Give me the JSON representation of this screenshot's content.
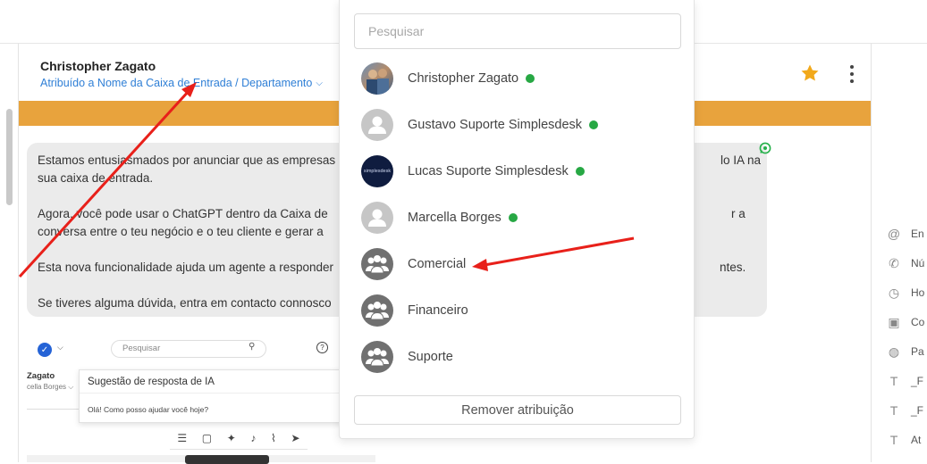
{
  "conversation": {
    "contact_name": "Christopher Zagato",
    "assignment_label": "Atribuído a Nome da Caixa de Entrada / Departamento",
    "message": {
      "para1_left": "Estamos entusiasmados por anunciar que as empresas",
      "para1_left2": "sua caixa de entrada.",
      "para1_right": "lo IA na",
      "para2_left": "Agora, você pode usar o ChatGPT dentro da Caixa de",
      "para2_left2": "conversa entre o teu negócio e o teu cliente e gerar a",
      "para2_right": "r a",
      "para3_left": "Esta nova funcionalidade ajuda um agente a responder",
      "para3_right": "ntes.",
      "para4_left": "Se tiveres alguma dúvida, entra em contacto connosco"
    }
  },
  "embedded_screenshot": {
    "search_placeholder": "Pesquisar",
    "contact_name": "Zagato",
    "contact_sub": "cella Borges",
    "ai_title": "Sugestão de resposta de IA",
    "ai_text": "Olá! Como posso ajudar você hoje?"
  },
  "right_panel": {
    "rows": [
      {
        "icon": "at-icon",
        "label": "En"
      },
      {
        "icon": "phone-icon",
        "label": "Nú"
      },
      {
        "icon": "clock-icon",
        "label": "Ho"
      },
      {
        "icon": "contact-card-icon",
        "label": "Co"
      },
      {
        "icon": "globe-icon",
        "label": "Pa"
      },
      {
        "icon": "text-field-icon",
        "label": "_F"
      },
      {
        "icon": "text-field-icon",
        "label": "_F"
      },
      {
        "icon": "text-field-icon",
        "label": "At"
      }
    ]
  },
  "assign_dropdown": {
    "search_placeholder": "Pesquisar",
    "items": [
      {
        "label": "Christopher Zagato",
        "online": true,
        "avatar": "photo"
      },
      {
        "label": "Gustavo Suporte Simplesdesk",
        "online": true,
        "avatar": "default-user"
      },
      {
        "label": "Lucas Suporte Simplesdesk",
        "online": true,
        "avatar": "simplesdesk-logo",
        "avatar_text": "simplesdesk"
      },
      {
        "label": "Marcella Borges",
        "online": true,
        "avatar": "default-user"
      },
      {
        "label": "Comercial",
        "online": false,
        "avatar": "team"
      },
      {
        "label": "Financeiro",
        "online": false,
        "avatar": "team"
      },
      {
        "label": "Suporte",
        "online": false,
        "avatar": "team"
      }
    ],
    "remove_label": "Remover atribuição"
  },
  "colors": {
    "accent_orange": "#e8a33d",
    "link_blue": "#2f7fd6",
    "online_green": "#27a844",
    "annotation_red": "#e8201a",
    "star_gold": "#f2a91b"
  }
}
